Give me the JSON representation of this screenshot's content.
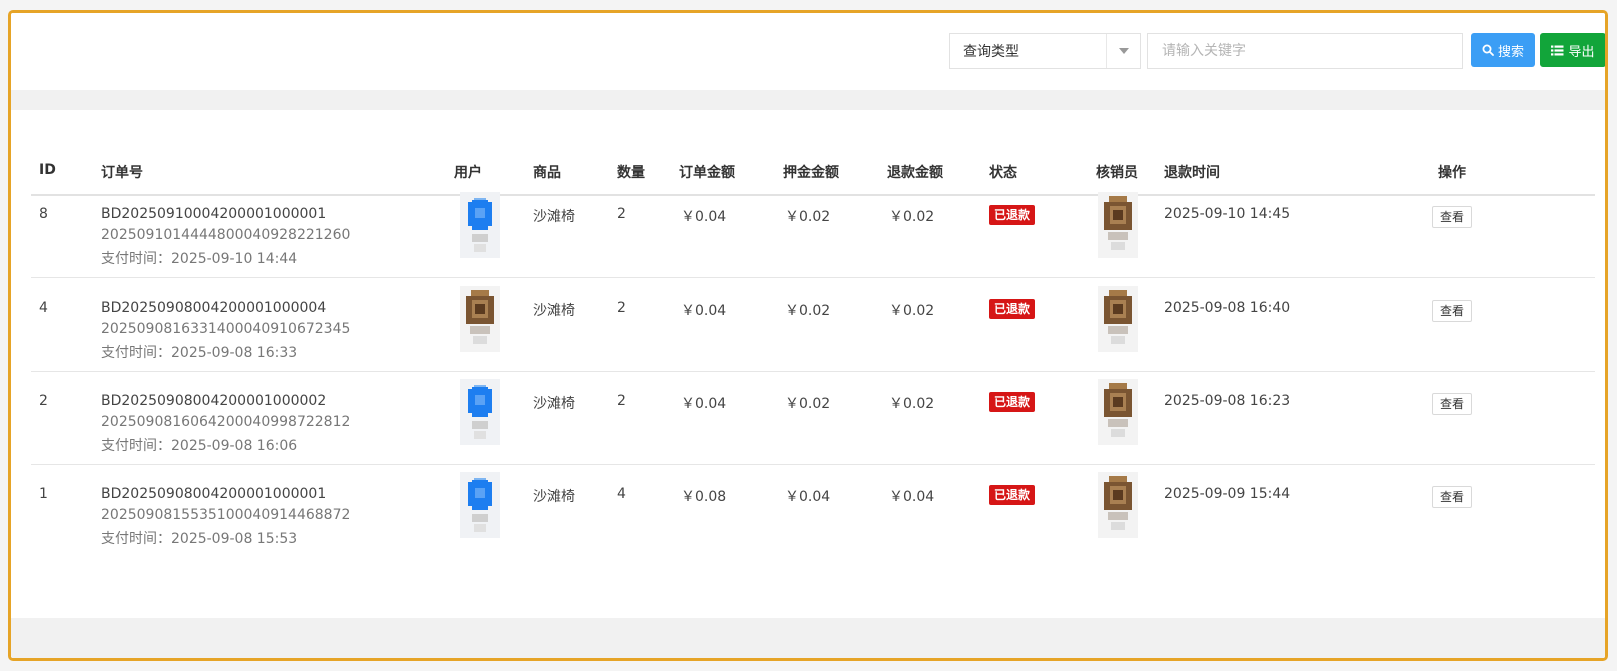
{
  "toolbar": {
    "query_type": "查询类型",
    "keyword_placeholder": "请输入关键字",
    "search_label": "搜索",
    "export_label": "导出"
  },
  "colors": {
    "accent_blue": "#3b9ef5",
    "accent_green": "#12a53a",
    "status_red": "#d61616",
    "frame_orange": "#e6a427"
  },
  "table": {
    "headers": {
      "id": "ID",
      "order_no": "订单号",
      "user": "用户",
      "goods": "商品",
      "qty": "数量",
      "order_amount": "订单金额",
      "deposit": "押金金额",
      "refund": "退款金额",
      "status": "状态",
      "verifier": "核销员",
      "refund_time": "退款时间",
      "action": "操作"
    },
    "rows": [
      {
        "id": "8",
        "order_no": "BD2025091000420000100000​1",
        "trade_no": "20250910144448000409282212​60",
        "pay_time": "支付时间：2025-09-10 14:44",
        "user_avatar": "blue-avatar-icon",
        "goods": "沙滩椅",
        "qty": "2",
        "order_amount": "￥0.04",
        "deposit": "￥0.02",
        "refund": "￥0.02",
        "status": "已退款",
        "verifier_avatar": "brown-avatar-icon",
        "refund_time": "2025-09-10 14:45",
        "action": "查看"
      },
      {
        "id": "4",
        "order_no": "BD20250908004200001000004",
        "trade_no": "20250908163314000409106723​45",
        "pay_time": "支付时间：2025-09-08 16:33",
        "user_avatar": "brown-avatar-icon",
        "goods": "沙滩椅",
        "qty": "2",
        "order_amount": "￥0.04",
        "deposit": "￥0.02",
        "refund": "￥0.02",
        "status": "已退款",
        "verifier_avatar": "brown-avatar-icon",
        "refund_time": "2025-09-08 16:40",
        "action": "查看"
      },
      {
        "id": "2",
        "order_no": "BD20250908004200001000002",
        "trade_no": "20250908160642000409987228​12",
        "pay_time": "支付时间：2025-09-08 16:06",
        "user_avatar": "blue-avatar-icon",
        "goods": "沙滩椅",
        "qty": "2",
        "order_amount": "￥0.04",
        "deposit": "￥0.02",
        "refund": "￥0.02",
        "status": "已退款",
        "verifier_avatar": "brown-avatar-icon",
        "refund_time": "2025-09-08 16:23",
        "action": "查看"
      },
      {
        "id": "1",
        "order_no": "BD20250908004200001000001",
        "trade_no": "20250908155351000409144688​72",
        "pay_time": "支付时间：2025-09-08 15:53",
        "user_avatar": "blue-avatar-icon",
        "goods": "沙滩椅",
        "qty": "4",
        "order_amount": "￥0.08",
        "deposit": "￥0.04",
        "refund": "￥0.04",
        "status": "已退款",
        "verifier_avatar": "brown-avatar-icon",
        "refund_time": "2025-09-09 15:44",
        "action": "查看"
      }
    ]
  }
}
